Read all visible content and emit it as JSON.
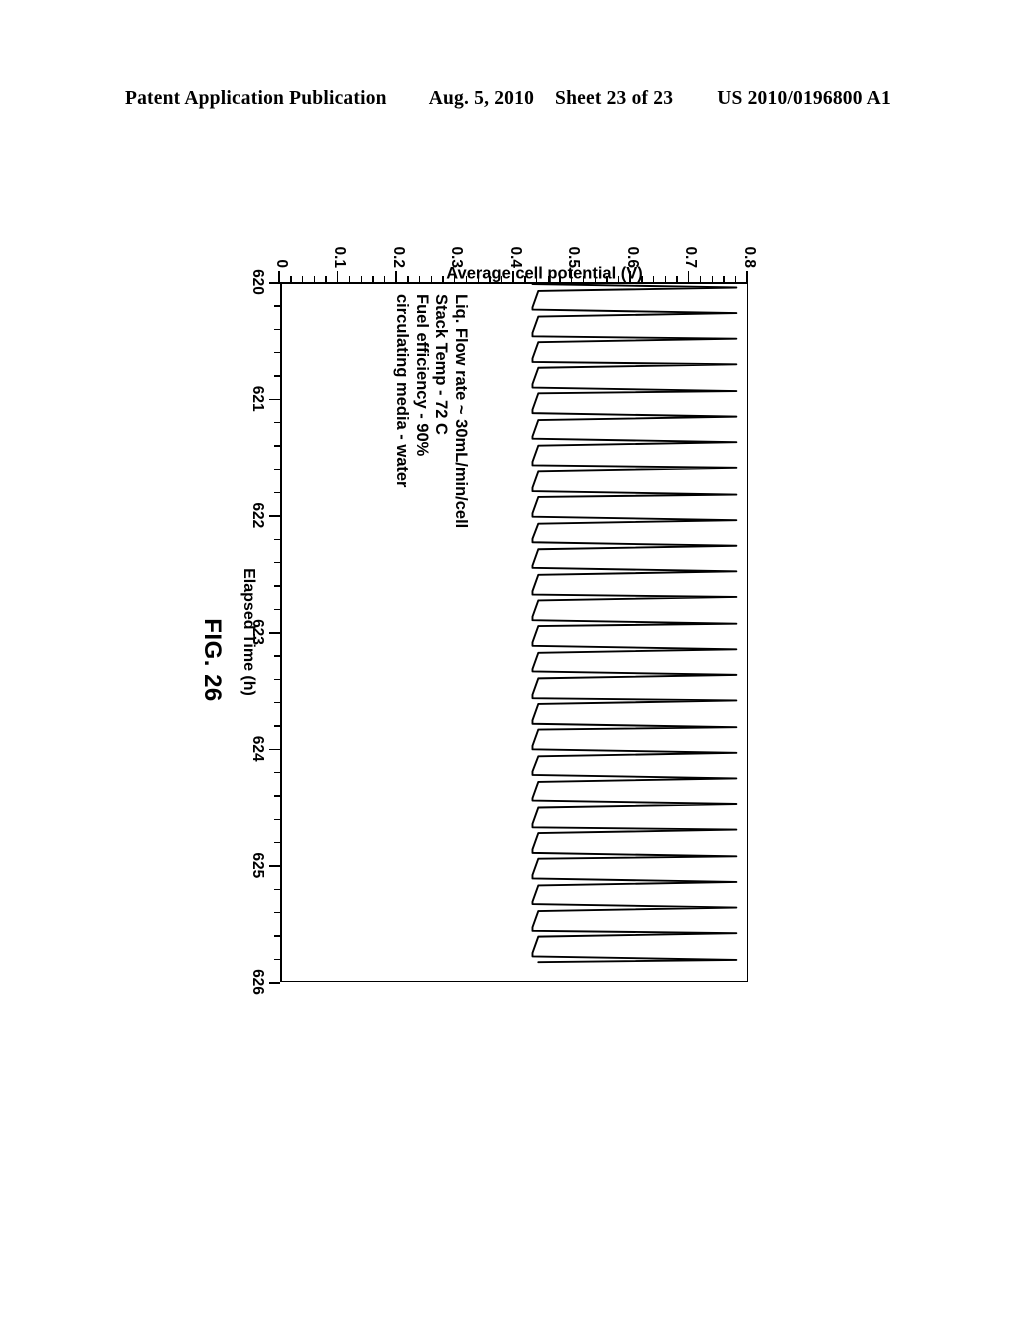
{
  "header": {
    "publication": "Patent Application Publication",
    "date": "Aug. 5, 2010",
    "sheet": "Sheet 23 of 23",
    "number": "US 2010/0196800 A1"
  },
  "figure": {
    "caption": "FIG. 26"
  },
  "annotations": [
    "Liq. Flow rate ~ 30mL/min/cell",
    "Stack Temp - 72 C",
    "Fuel efficiency - 90%",
    "circulating media - water"
  ],
  "chart_data": {
    "type": "line",
    "title": "",
    "xlabel": "Elapsed Time (h)",
    "ylabel": "Average cell potential (V)",
    "xlim": [
      620,
      626
    ],
    "ylim": [
      0,
      0.8
    ],
    "xticks": [
      620,
      621,
      622,
      623,
      624,
      625,
      626
    ],
    "xtick_labels": [
      "620",
      "621",
      "622",
      "623",
      "624",
      "625",
      "626"
    ],
    "yticks": [
      0,
      0.1,
      0.2,
      0.3,
      0.4,
      0.5,
      0.6,
      0.7,
      0.8
    ],
    "ytick_labels": [
      "0",
      "0.1",
      "0.2",
      "0.3",
      "0.4",
      "0.5",
      "0.6",
      "0.7",
      "0.8"
    ],
    "x_minor_tick_step": 0.2,
    "y_minor_tick_step": 0.02,
    "grid": false,
    "legend": null,
    "rotated_90": true,
    "y_axis_reversed_on_page": true,
    "baseline_voltage": 0.43,
    "peak_voltage": 0.78,
    "cycle_period_hours": 0.2222,
    "cycle_count": 27,
    "spike_width_hours": 0.035,
    "series": [
      {
        "name": "Average cell potential",
        "description": "Periodic fuel-cell refresh cycles: steady plateau near 0.43 V interrupted by sharp excursions to about 0.78 V at the start of each cycle.",
        "x": [
          620.0,
          620.03,
          620.06,
          620.2,
          620.22,
          620.25,
          620.28,
          620.42,
          620.45,
          620.47,
          620.5,
          620.64,
          620.67,
          620.69,
          620.72,
          620.86,
          620.89,
          620.92,
          620.94,
          621.08,
          621.11,
          621.14,
          621.17,
          621.31,
          621.33,
          621.36,
          621.39,
          621.53,
          621.56,
          621.58,
          621.61,
          621.75,
          621.78,
          621.81,
          621.83,
          621.97,
          622.0,
          622.03,
          622.06,
          622.19,
          622.22,
          622.25,
          622.28,
          622.42,
          622.44,
          622.47,
          622.5,
          622.64,
          622.67,
          622.69,
          622.72,
          622.86,
          622.89,
          622.92,
          622.94,
          623.08,
          623.11,
          623.14,
          623.17,
          623.31,
          623.33,
          623.36,
          623.39,
          623.53,
          623.56,
          623.58,
          623.61,
          623.75,
          623.78,
          623.81,
          623.83,
          623.97,
          624.0,
          624.03,
          624.06,
          624.19,
          624.22,
          624.25,
          624.28,
          624.42,
          624.44,
          624.47,
          624.5,
          624.64,
          624.67,
          624.69,
          624.72,
          624.86,
          624.89,
          624.92,
          624.94,
          625.08,
          625.11,
          625.14,
          625.17,
          625.31,
          625.33,
          625.36,
          625.39,
          625.53,
          625.56,
          625.58,
          625.61,
          625.75,
          625.78,
          625.81,
          625.83,
          625.97,
          626.0
        ],
        "y": [
          0.43,
          0.78,
          0.44,
          0.43,
          0.43,
          0.78,
          0.44,
          0.43,
          0.43,
          0.78,
          0.44,
          0.43,
          0.43,
          0.78,
          0.44,
          0.43,
          0.43,
          0.78,
          0.44,
          0.43,
          0.43,
          0.78,
          0.44,
          0.43,
          0.43,
          0.78,
          0.44,
          0.43,
          0.43,
          0.78,
          0.44,
          0.43,
          0.43,
          0.78,
          0.44,
          0.43,
          0.43,
          0.78,
          0.44,
          0.43,
          0.43,
          0.78,
          0.44,
          0.43,
          0.43,
          0.78,
          0.44,
          0.43,
          0.43,
          0.78,
          0.44,
          0.43,
          0.43,
          0.78,
          0.44,
          0.43,
          0.43,
          0.78,
          0.44,
          0.43,
          0.43,
          0.78,
          0.44,
          0.43,
          0.43,
          0.78,
          0.44,
          0.43,
          0.43,
          0.78,
          0.44,
          0.43,
          0.43,
          0.78,
          0.44,
          0.43,
          0.43,
          0.78,
          0.44,
          0.43,
          0.43,
          0.78,
          0.44,
          0.43,
          0.43,
          0.78,
          0.44,
          0.43,
          0.43,
          0.78,
          0.44,
          0.43,
          0.43,
          0.78,
          0.44,
          0.43,
          0.43,
          0.78,
          0.44,
          0.43,
          0.43,
          0.78,
          0.44,
          0.43,
          0.43,
          0.78,
          0.44
        ]
      }
    ]
  }
}
